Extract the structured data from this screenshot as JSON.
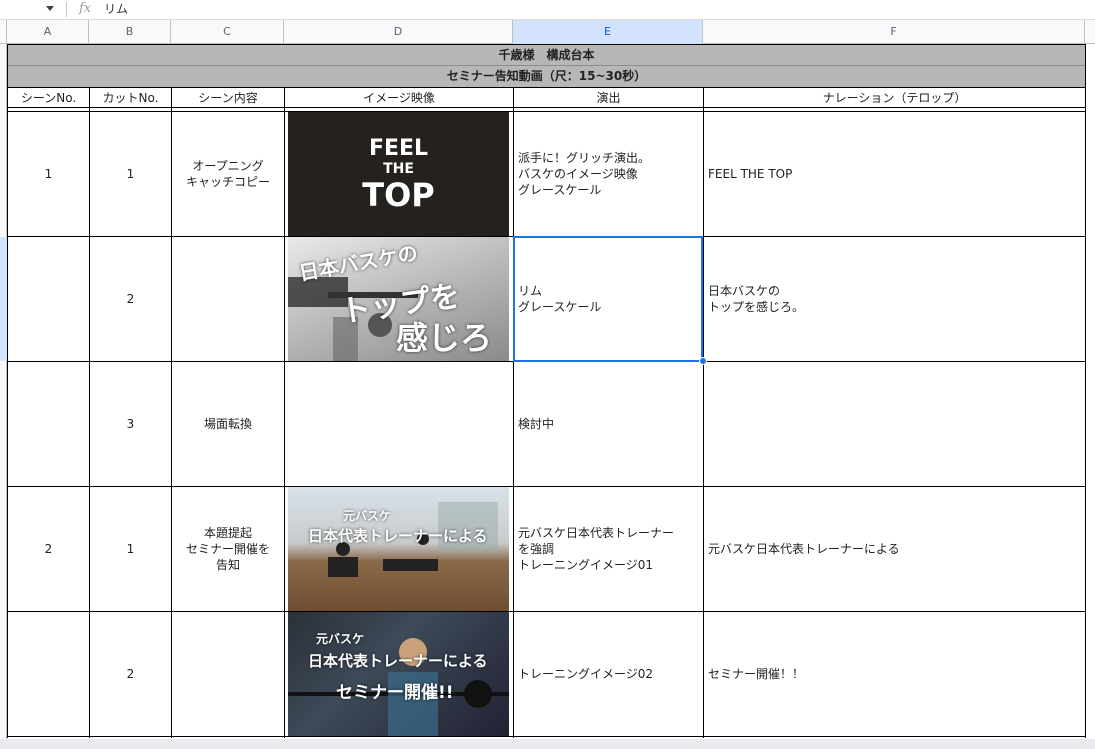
{
  "formula_bar": {
    "fx": "fx",
    "value": "リム"
  },
  "columns": [
    "A",
    "B",
    "C",
    "D",
    "E",
    "F"
  ],
  "sheet": {
    "title": "千歳様　構成台本",
    "subtitle": "セミナー告知動画（尺：15~30秒）",
    "headers": [
      "シーンNo.",
      "カットNo.",
      "シーン内容",
      "イメージ映像",
      "演出",
      "ナレーション（テロップ）"
    ],
    "rows": [
      {
        "scene": "1",
        "cut": "1",
        "content": "オープニング\nキャッチコピー",
        "effect": "派手に！グリッチ演出。\nバスケのイメージ映像\nグレースケール",
        "narration": "FEEL THE TOP"
      },
      {
        "scene": "",
        "cut": "2",
        "content": "",
        "effect": "リム\nグレースケール",
        "narration": "日本バスケの\nトップを感じろ。"
      },
      {
        "scene": "",
        "cut": "3",
        "content": "場面転換",
        "effect": "検討中",
        "narration": ""
      },
      {
        "scene": "2",
        "cut": "1",
        "content": "本題提起\nセミナー開催を\n告知",
        "effect": "元バスケ日本代表トレーナー\nを強調\nトレーニングイメージ01",
        "narration": "元バスケ日本代表トレーナーによる"
      },
      {
        "scene": "",
        "cut": "2",
        "content": "",
        "effect": "トレーニングイメージ02",
        "narration": "セミナー開催！！"
      }
    ]
  },
  "images": {
    "img1": {
      "line1": "FEEL",
      "line2": "THE",
      "line3": "TOP"
    },
    "img2": {
      "line1": "日本バスケの",
      "line2": "トップを",
      "line3": "感じろ"
    },
    "img3": {
      "line1": "元バスケ",
      "line2": "日本代表トレーナーによる"
    },
    "img4": {
      "line1": "元バスケ",
      "line2": "日本代表トレーナーによる",
      "line3": "セミナー開催!!"
    }
  },
  "colors": {
    "header_fill": "#b7b7b7",
    "selection": "#1a73e8",
    "selected_col_header": "#d3e3fd"
  }
}
